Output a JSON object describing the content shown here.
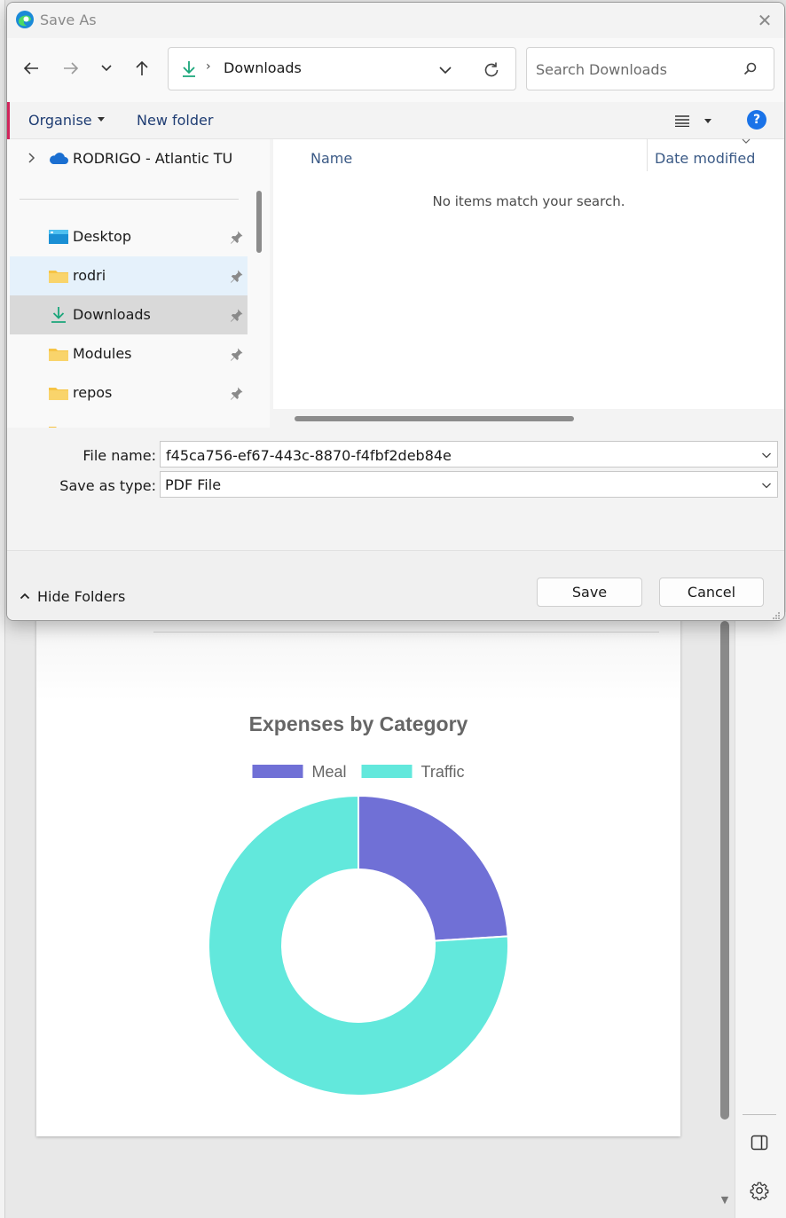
{
  "dialog": {
    "title": "Save As",
    "address": {
      "current_folder": "Downloads"
    },
    "search": {
      "placeholder": "Search Downloads"
    },
    "commands": {
      "organise": "Organise",
      "new_folder": "New folder",
      "help": "?"
    },
    "nav_pane": {
      "account": "RODRIGO - Atlantic TU",
      "items": [
        {
          "label": "Desktop"
        },
        {
          "label": "rodri"
        },
        {
          "label": "Downloads"
        },
        {
          "label": "Modules"
        },
        {
          "label": "repos"
        }
      ]
    },
    "file_list": {
      "columns": [
        "Name",
        "Date modified"
      ],
      "empty_message": "No items match your search."
    },
    "file_name": {
      "label": "File name:",
      "value": "f45ca756-ef67-443c-8870-f4fbf2deb84e"
    },
    "save_as_type": {
      "label": "Save as type:",
      "value": "PDF File"
    },
    "footer": {
      "hide_folders": "Hide Folders",
      "save": "Save",
      "cancel": "Cancel"
    }
  },
  "colors": {
    "accent": "#1a73e8",
    "meal": "#7070d6",
    "traffic": "#62e8dc",
    "download_green": "#1aa67a",
    "folder_yellow": "#f6c445"
  },
  "chart_data": {
    "type": "pie",
    "variant": "doughnut",
    "title": "Expenses by Category",
    "legend_position": "top",
    "categories": [
      "Meal",
      "Traffic"
    ],
    "values": [
      24,
      76
    ],
    "colors": [
      "#7070d6",
      "#62e8dc"
    ]
  }
}
